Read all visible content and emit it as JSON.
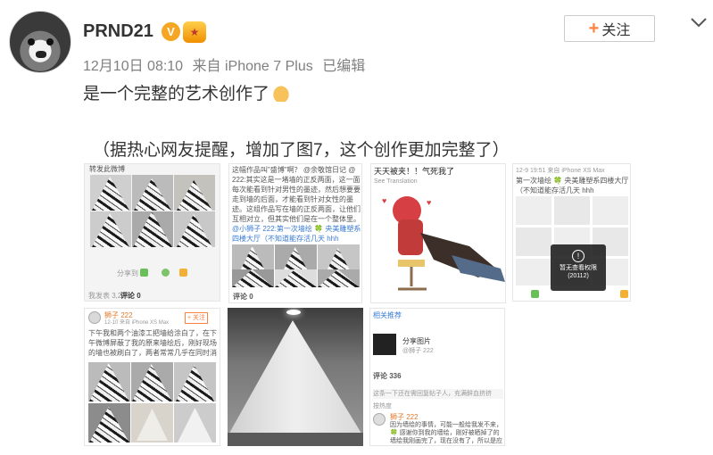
{
  "post": {
    "username": "PRND21",
    "verified_badge": "V",
    "timestamp": "12月10日 08:10",
    "source": "来自 iPhone 7 Plus",
    "edited": "已编辑",
    "follow_label": "关注",
    "text_line1": "是一个完整的艺术创作了",
    "text_line2": "（据热心网友提醒，增加了图7，这个创作更加完整了）"
  },
  "thumbs": {
    "t1": {
      "top_text": "转发此微博",
      "share_label": "分享到",
      "footer_text": "我发表 3,271",
      "comments_label": "评论 0"
    },
    "t2": {
      "top_text": "这幅作品叫\"盛博\"啊？ @余敬馆日记 @小狮子",
      "body_text": "222:其实这是一堵墙的正反两面，这一面每次能看到针对男性的墨迹，然后想要要走到墙的后面，才能看到针对女性的墨迹。这组作品写在墙的正反两面，让他们互相对立，但其实他们是在一个整体里。",
      "quote_text": "@小狮子 222:第一次墙绘 🍀 央美雕塑系四楼大厅（不知道能存活几天 hhh",
      "comments_label": "评论 0"
    },
    "t3": {
      "caption": "天天被夹！！气死我了",
      "sub": "See Translation"
    },
    "t4": {
      "date": "12-9 19:51 来自 iPhone XS Max",
      "body": "第一次墙绘 🍀 央美雕塑系四楼大厅（不知道能存活几天 hhh",
      "popup_title": "暂无查看权限",
      "popup_code": "(20112)"
    },
    "t5": {
      "name": "狮子 222",
      "date": "12-10 来自 iPhone XS Max",
      "follow": "+ 关注",
      "body": "下午我和两个油漆工把墙给涂白了，在下午微博屏蔽了我的原来墙绘后，刚好现场的墙也被刷白了，两者常常几乎在同时消失。刚刚好看样子了，一天。",
      "comments_label": "评论 0"
    },
    "t7": {
      "top_tag": "相关推荐",
      "card_title": "分享图片",
      "card_sub": "@狮子 222",
      "comments_label": "评论 336",
      "reply_placeholder": "这条一下还在需回复帖子人，充满鲜血挤挤",
      "sort_label": "按热度",
      "commenter": "狮子 222",
      "comment": "因为墙绘的事情，可能一般给我发不来，🍀 感谢你到我的墙绘，刚好被晒掉了的墙绘我刚画完了，现在没有了，所以是应该墙绘。"
    }
  },
  "colors": {
    "follow_plus": "#ff8140",
    "meta_gray": "#808080",
    "text": "#333333",
    "link_blue": "#3a7bd5"
  }
}
